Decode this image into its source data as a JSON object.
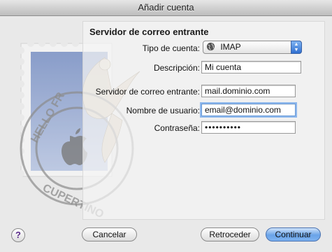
{
  "window": {
    "title": "Añadir cuenta"
  },
  "panel": {
    "title": "Servidor de correo entrante"
  },
  "form": {
    "account_type": {
      "label": "Tipo de cuenta:",
      "value": "IMAP"
    },
    "description": {
      "label": "Descripción:",
      "value": "Mi cuenta"
    },
    "incoming_server": {
      "label": "Servidor de correo entrante:",
      "value": "mail.dominio.com"
    },
    "username": {
      "label": "Nombre de usuario:",
      "value": "email@dominio.com"
    },
    "password": {
      "label": "Contraseña:",
      "value": "••••••••••"
    }
  },
  "stamp": {
    "text_top": "HELLO FR",
    "text_bottom": "CUPERTINO"
  },
  "buttons": {
    "help": "?",
    "cancel": "Cancelar",
    "back": "Retroceder",
    "continue": "Continuar"
  },
  "icons": {
    "help": "help-icon",
    "globe": "globe-icon",
    "stepper": "popup-stepper-icon"
  }
}
